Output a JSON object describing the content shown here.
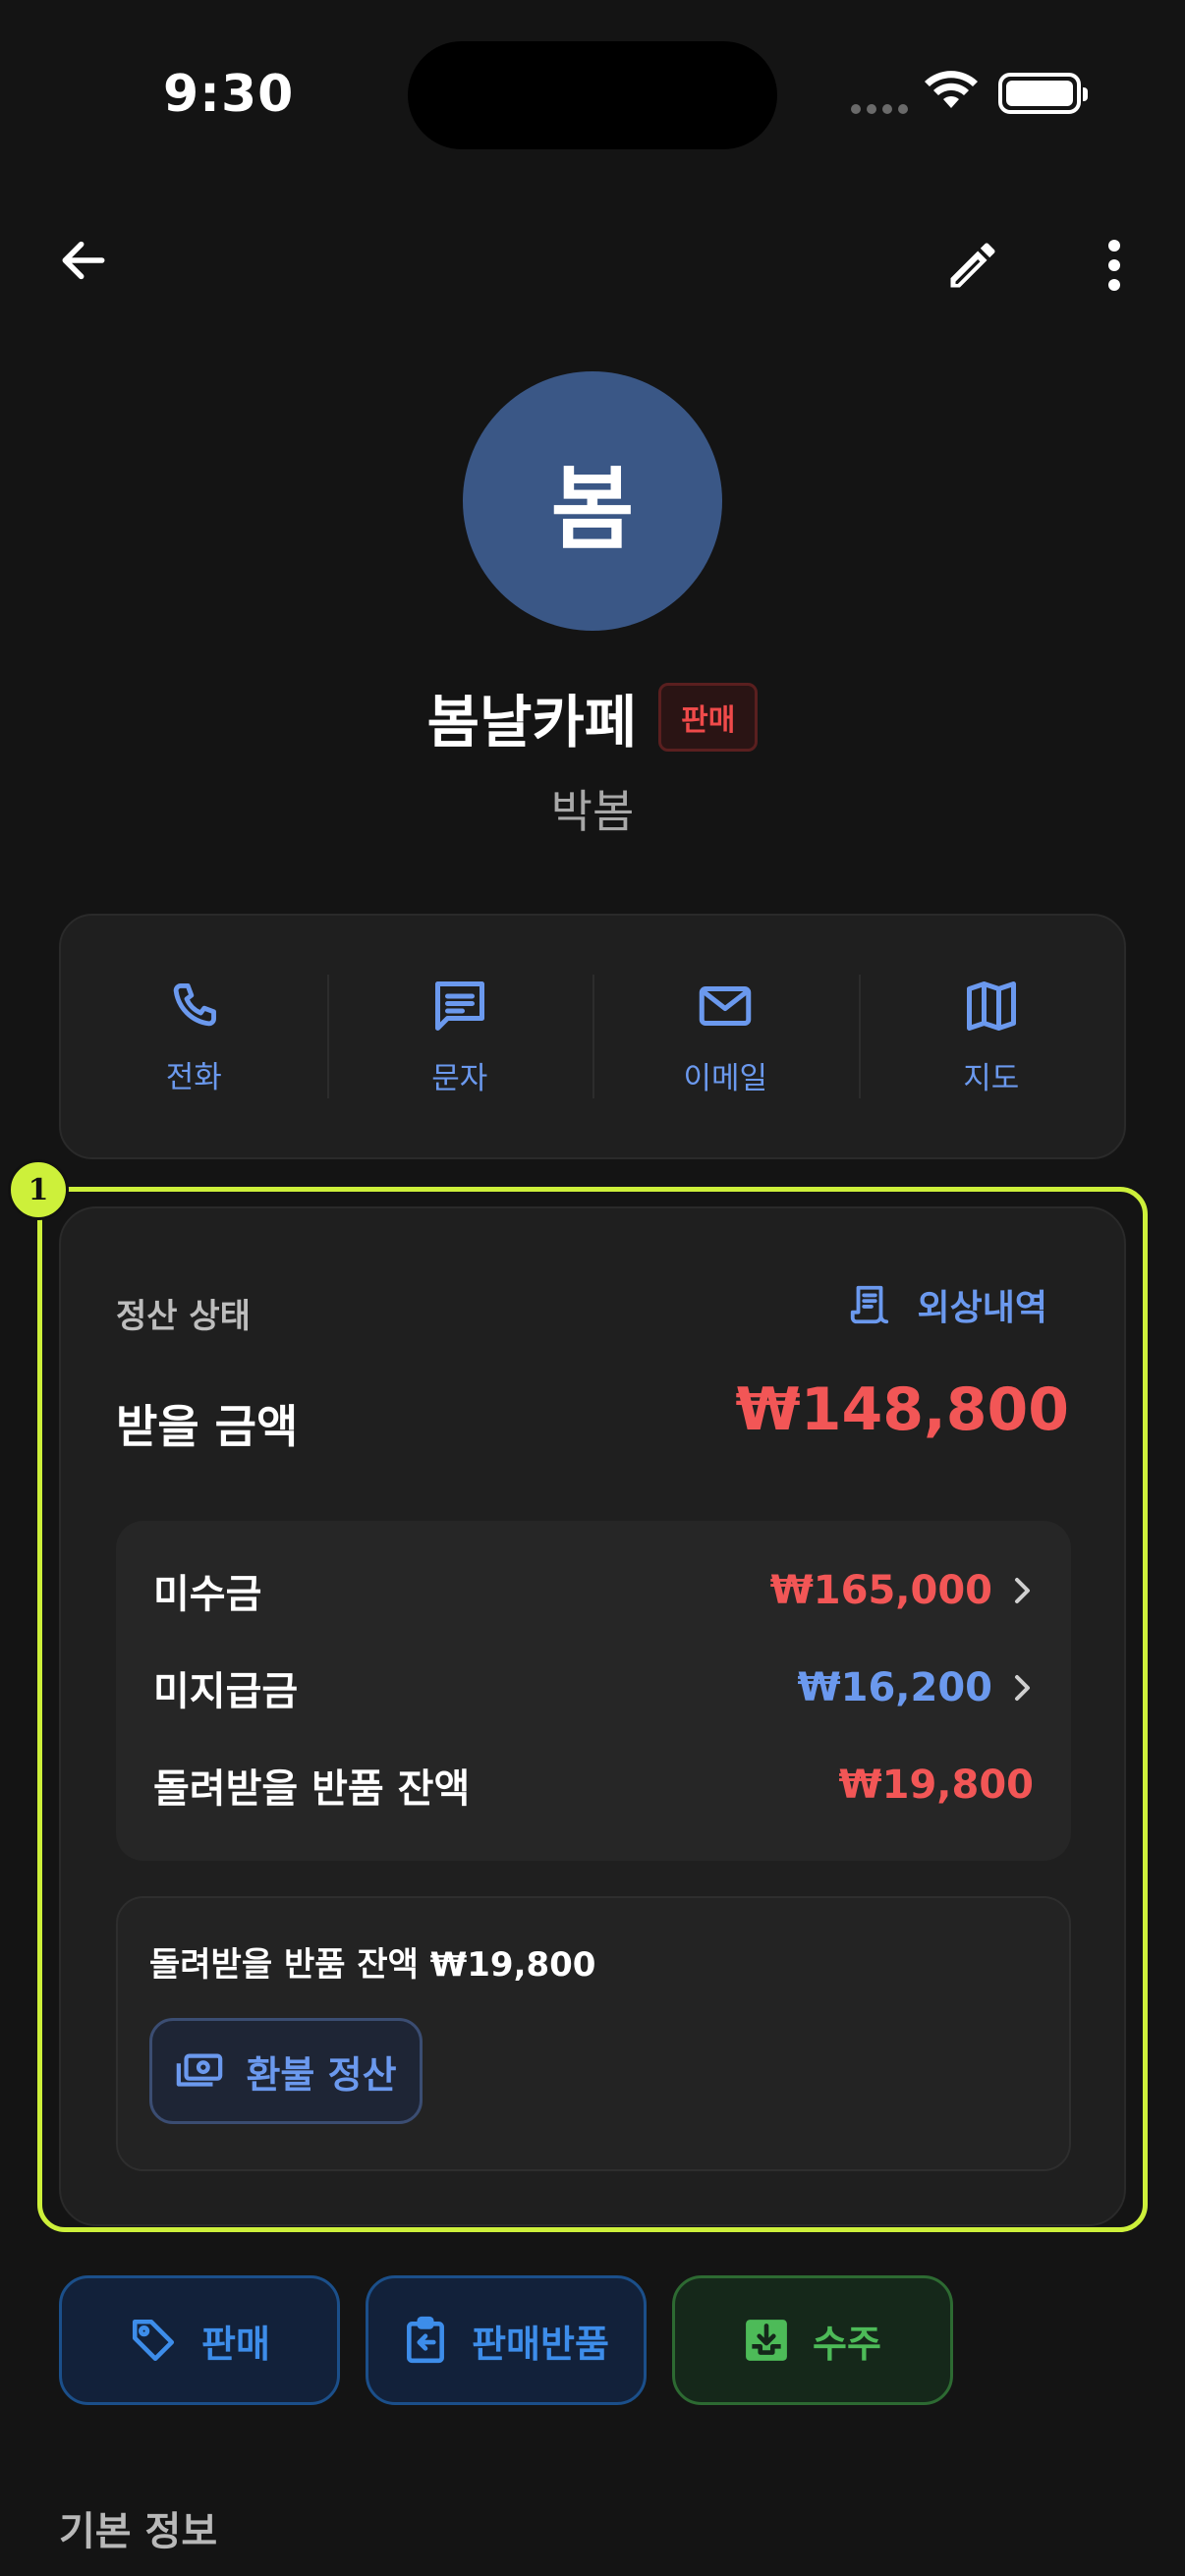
{
  "status_bar": {
    "time": "9:30"
  },
  "profile": {
    "avatar_initial": "봄",
    "name": "봄날카페",
    "badge": "판매",
    "contact_person": "박봄"
  },
  "actions": [
    {
      "label": "전화",
      "icon": "phone-icon"
    },
    {
      "label": "문자",
      "icon": "message-icon"
    },
    {
      "label": "이메일",
      "icon": "mail-icon"
    },
    {
      "label": "지도",
      "icon": "map-icon"
    }
  ],
  "highlight": {
    "number": "1"
  },
  "settlement": {
    "status_label": "정산 상태",
    "ledger_link": "외상내역",
    "receivable_label": "받을 금액",
    "receivable_amount": "₩148,800",
    "rows": [
      {
        "label": "미수금",
        "amount": "₩165,000"
      },
      {
        "label": "미지급금",
        "amount": "₩16,200"
      },
      {
        "label": "돌려받을 반품 잔액",
        "amount": "₩19,800"
      }
    ],
    "refund_text": "돌려받을 반품 잔액 ₩19,800",
    "refund_button": "환불 정산"
  },
  "quick_actions": {
    "sale": "판매",
    "sale_return": "판매반품",
    "order": "수주"
  },
  "section_title": "기본 정보",
  "colors": {
    "accent_blue": "#6b99ee",
    "amount_red": "#f25656",
    "highlight": "#cdf03a",
    "avatar_bg": "#3a5786"
  }
}
